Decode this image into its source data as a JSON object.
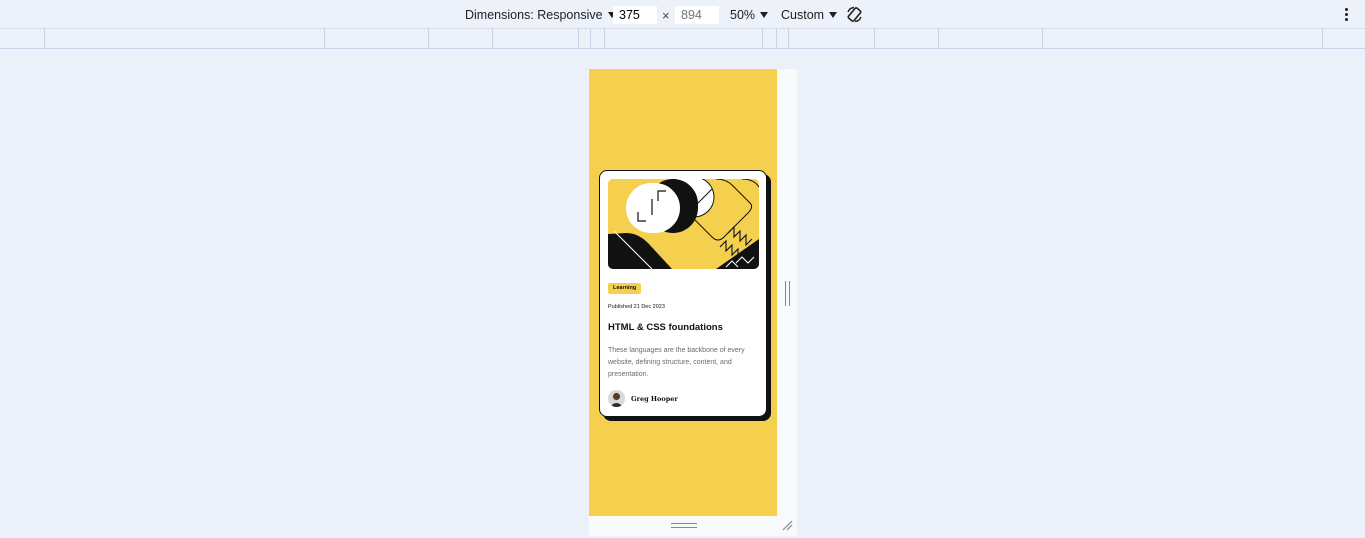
{
  "toolbar": {
    "dimensions_label": "Dimensions: Responsive",
    "width_value": "375",
    "height_placeholder": "894",
    "times_symbol": "×",
    "zoom_label": "50%",
    "throttle_label": "Custom",
    "rotate_icon": "rotate-icon",
    "more_icon": "kebab-menu-icon"
  },
  "card": {
    "category": "Learning",
    "published": "Published 21 Dec 2023",
    "title": "HTML & CSS foundations",
    "description": "These languages are the backbone of every website, defining structure, content, and presentation.",
    "author": "Greg Hooper"
  },
  "colors": {
    "accent_yellow": "#f4d04e",
    "ink": "#111111",
    "muted_text": "#6b6b6b",
    "toolbar_bg": "#edf1f9",
    "page_bg": "#ecf0f8"
  }
}
